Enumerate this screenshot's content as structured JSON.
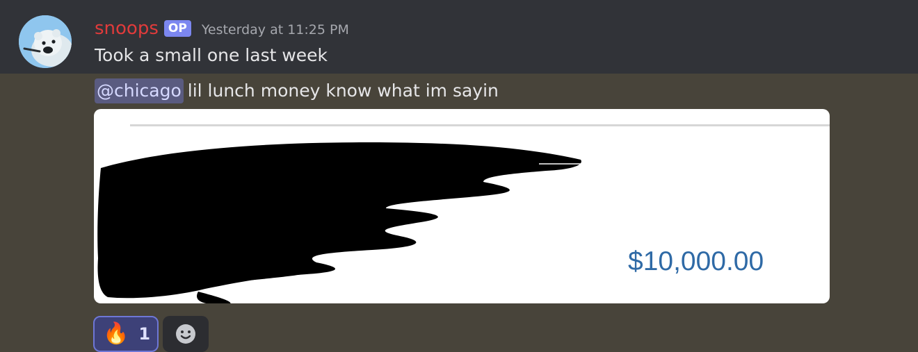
{
  "message": {
    "author": "snoops",
    "badge": "OP",
    "timestamp": "Yesterday at 11:25 PM",
    "line1": "Took a small one last week",
    "mention": "@chicago",
    "line2": "lil lunch money know what im sayin",
    "avatar_icon": "polar-bear-avatar"
  },
  "attachment": {
    "amount": "$10,000.00",
    "redaction_icon": "scribble-redaction"
  },
  "reactions": [
    {
      "emoji": "🔥",
      "emoji_icon": "fire-icon",
      "count": "1"
    }
  ],
  "add_reaction_icon": "smile-icon",
  "colors": {
    "top_background": "#313338",
    "bottom_background": "#48443a",
    "username": "#e03b3b",
    "op_badge": "#7c87f0",
    "mention_bg": "#5a5b80",
    "amount": "#2f6aa6"
  }
}
